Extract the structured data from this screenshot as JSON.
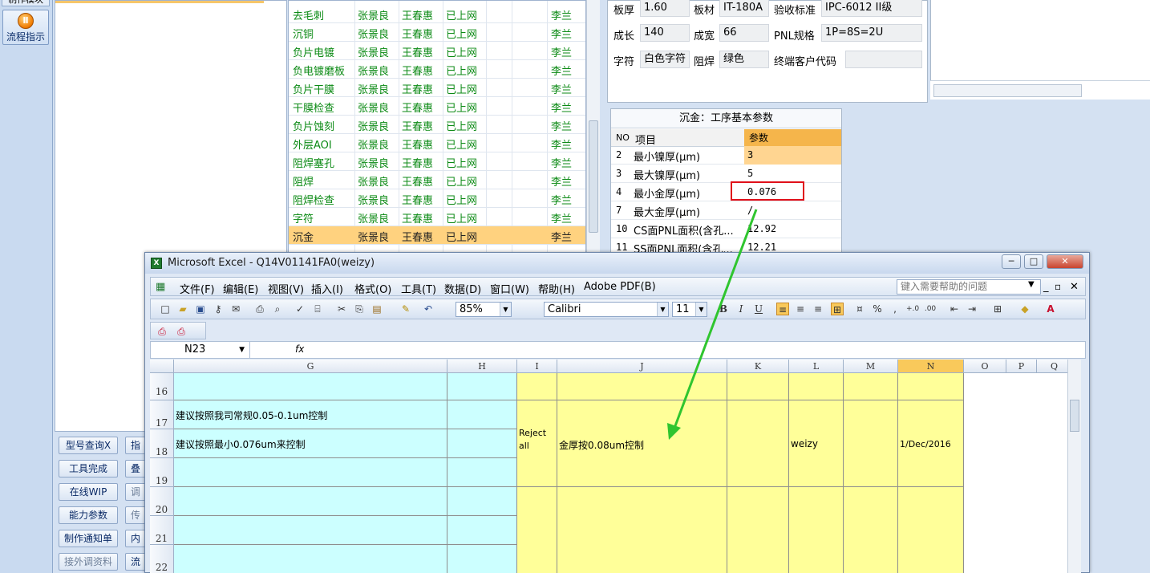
{
  "left_toolbar": {
    "top_button": "制作模块",
    "flow_button": "流程指示"
  },
  "buttons": [
    {
      "label": "型号查询X",
      "enabled": true
    },
    {
      "label": "指",
      "enabled": true
    },
    {
      "label": "工具完成",
      "enabled": true
    },
    {
      "label": "叠",
      "enabled": true
    },
    {
      "label": "在线WIP",
      "enabled": true
    },
    {
      "label": "调",
      "enabled": false
    },
    {
      "label": "能力参数",
      "enabled": true
    },
    {
      "label": "传",
      "enabled": false
    },
    {
      "label": "制作通知单",
      "enabled": true
    },
    {
      "label": "内",
      "enabled": true
    },
    {
      "label": "接外调资料",
      "enabled": false
    },
    {
      "label": "流",
      "enabled": true
    }
  ],
  "process_rows": [
    {
      "step": "去毛刺",
      "a": "张景良",
      "b": "王春惠",
      "status": "已上网",
      "owner": "李兰"
    },
    {
      "step": "沉铜",
      "a": "张景良",
      "b": "王春惠",
      "status": "已上网",
      "owner": "李兰"
    },
    {
      "step": "负片电镀",
      "a": "张景良",
      "b": "王春惠",
      "status": "已上网",
      "owner": "李兰"
    },
    {
      "step": "负电镀磨板",
      "a": "张景良",
      "b": "王春惠",
      "status": "已上网",
      "owner": "李兰"
    },
    {
      "step": "负片干膜",
      "a": "张景良",
      "b": "王春惠",
      "status": "已上网",
      "owner": "李兰"
    },
    {
      "step": "干膜检查",
      "a": "张景良",
      "b": "王春惠",
      "status": "已上网",
      "owner": "李兰"
    },
    {
      "step": "负片蚀刻",
      "a": "张景良",
      "b": "王春惠",
      "status": "已上网",
      "owner": "李兰"
    },
    {
      "step": "外层AOI",
      "a": "张景良",
      "b": "王春惠",
      "status": "已上网",
      "owner": "李兰"
    },
    {
      "step": "阻焊塞孔",
      "a": "张景良",
      "b": "王春惠",
      "status": "已上网",
      "owner": "李兰"
    },
    {
      "step": "阻焊",
      "a": "张景良",
      "b": "王春惠",
      "status": "已上网",
      "owner": "李兰"
    },
    {
      "step": "阻焊检查",
      "a": "张景良",
      "b": "王春惠",
      "status": "已上网",
      "owner": "李兰"
    },
    {
      "step": "字符",
      "a": "张景良",
      "b": "王春惠",
      "status": "已上网",
      "owner": "李兰"
    },
    {
      "step": "沉金",
      "a": "张景良",
      "b": "王春惠",
      "status": "已上网",
      "owner": "李兰"
    }
  ],
  "info": {
    "thickness_label": "板厚",
    "thickness": "1.60",
    "material_label": "板材",
    "material": "IT-180A",
    "standard_label": "验收标准",
    "standard": "IPC-6012 II级",
    "length_label": "成长",
    "length": "140",
    "width_label": "成宽",
    "width": "66",
    "pnl_label": "PNL规格",
    "pnl": "1P=8S=2U",
    "char_label": "字符",
    "char": "白色字符",
    "mask_label": "阻焊",
    "mask": "绿色",
    "customer_label": "终端客户代码",
    "customer": ""
  },
  "params": {
    "title": "沉金：工序基本参数",
    "col_no": "NO",
    "col_item": "项目",
    "col_param": "参数",
    "rows": [
      {
        "no": "2",
        "item": "最小镍厚(μm)",
        "value": "3"
      },
      {
        "no": "3",
        "item": "最大镍厚(μm)",
        "value": "5"
      },
      {
        "no": "4",
        "item": "最小金厚(μm)",
        "value": "0.076"
      },
      {
        "no": "7",
        "item": "最大金厚(μm)",
        "value": "/"
      },
      {
        "no": "10",
        "item": "CS面PNL面积(含孔...",
        "value": "12.92"
      },
      {
        "no": "11",
        "item": "SS面PNL面积(含孔...",
        "value": "12.21"
      }
    ]
  },
  "excel": {
    "title": "Microsoft Excel - Q14V01141FA0(weizy)",
    "menus": [
      "文件(F)",
      "编辑(E)",
      "视图(V)",
      "插入(I)",
      "格式(O)",
      "工具(T)",
      "数据(D)",
      "窗口(W)",
      "帮助(H)",
      "Adobe PDF(B)"
    ],
    "help_placeholder": "键入需要帮助的问题",
    "zoom": "85%",
    "font": "Calibri",
    "font_size": "11",
    "bold": "B",
    "italic": "I",
    "underline": "U",
    "percent": "%",
    "comma": ",",
    "name_box": "N23",
    "fx": "fx",
    "columns": [
      "G",
      "H",
      "I",
      "J",
      "K",
      "L",
      "M",
      "N",
      "O",
      "P",
      "Q"
    ],
    "row_numbers": [
      "16",
      "17",
      "18",
      "19",
      "20",
      "21",
      "22"
    ],
    "cells": {
      "g17": "建议按照我司常规0.05-0.1um控制",
      "g18": "建议按照最小0.076um来控制",
      "i18": "Reject all",
      "j18": "金厚按0.08um控制",
      "l18": "weizy",
      "n18": "1/Dec/2016"
    }
  },
  "colors": {
    "highlight_row": "#ffd27f",
    "annotation_box": "#e0101a",
    "arrow": "#2fc52f",
    "cyan_cell": "#ccffff",
    "yellow_cell": "#ffff99"
  }
}
